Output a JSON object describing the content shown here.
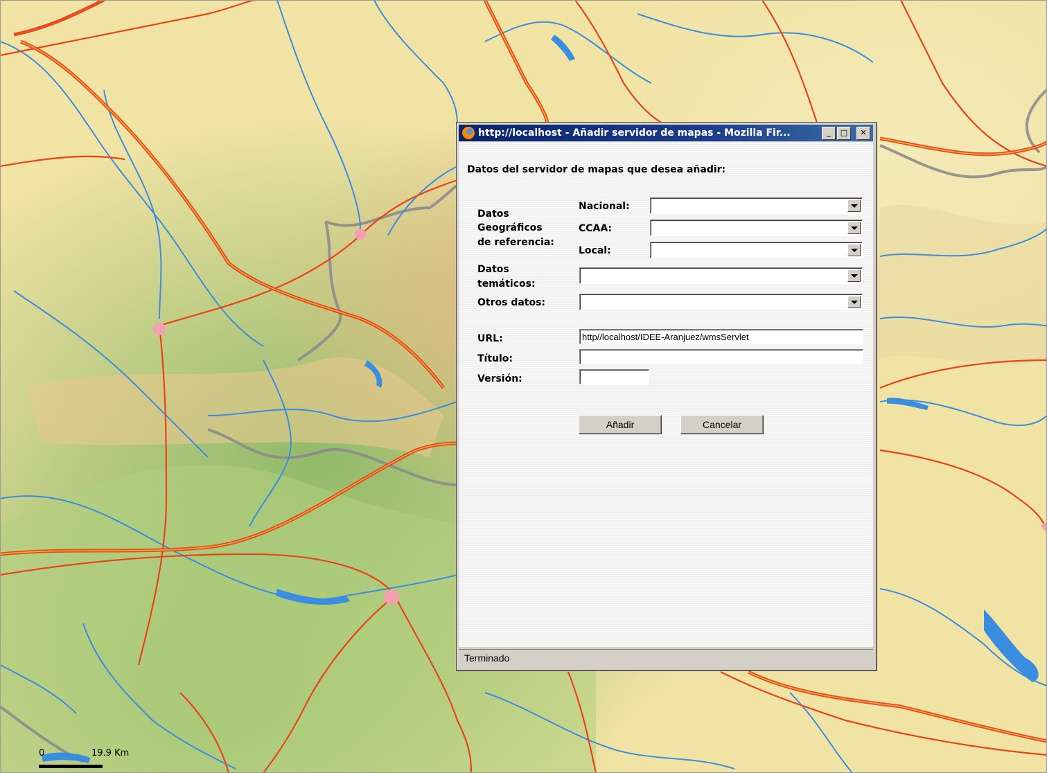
{
  "window": {
    "title": "http://localhost - Añadir servidor de mapas - Mozilla Fir...",
    "minimize_glyph": "_",
    "maximize_glyph": "□",
    "close_glyph": "✕"
  },
  "form": {
    "heading": "Datos del servidor de mapas que desea añadir:",
    "geo_group_label_1": "Datos",
    "geo_group_label_2": "Geográficos",
    "geo_group_label_3": "de referencia:",
    "nacional_label": "Nacional:",
    "ccaa_label": "CCAA:",
    "local_label": "Local:",
    "tematicos_label_1": "Datos",
    "tematicos_label_2": "temáticos:",
    "otros_label": "Otros datos:",
    "url_label": "URL:",
    "url_value": "http//localhost/IDEE-Aranjuez/wmsServlet",
    "titulo_label": "Título:",
    "titulo_value": "",
    "version_label": "Versión:",
    "version_value": "",
    "add_button": "Añadir",
    "cancel_button": "Cancelar"
  },
  "status": {
    "text": "Terminado"
  },
  "map": {
    "scale_zero": "0",
    "scale_distance": "19.9 Km",
    "colors": {
      "land_light": "#f1e6a8",
      "land_green": "#a8c878",
      "roads": "#e8441a",
      "motorway": "#f0a020",
      "rivers": "#3a8ee0",
      "borders": "#8c8c8c",
      "towns": "#f4a0b0"
    }
  }
}
